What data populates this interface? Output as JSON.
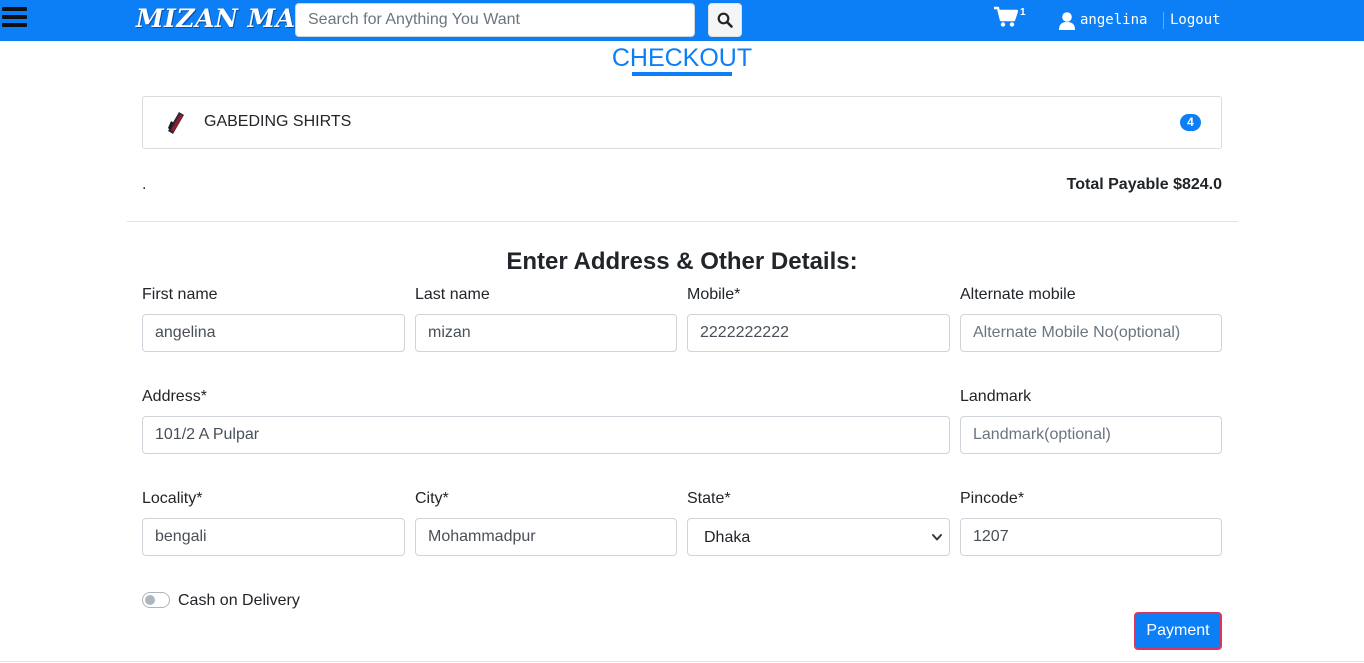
{
  "nav": {
    "brand": "MIZAN MART",
    "search_placeholder": "Search for Anything You Want",
    "cart_count": "1",
    "username": "angelina",
    "logout_label": "Logout"
  },
  "checkout": {
    "title": "CHECKOUT",
    "item": {
      "name": "GABEDING SHIRTS",
      "qty": "4"
    },
    "dot": ".",
    "total_label": "Total Payable $824.0"
  },
  "form": {
    "title": "Enter Address & Other Details:",
    "first_name": {
      "label": "First name",
      "value": "angelina"
    },
    "last_name": {
      "label": "Last name",
      "value": "mizan"
    },
    "mobile": {
      "label": "Mobile*",
      "value": "2222222222"
    },
    "alt_mobile": {
      "label": "Alternate mobile",
      "value": "",
      "placeholder": "Alternate Mobile No(optional)"
    },
    "address": {
      "label": "Address*",
      "value": "101/2 A Pulpar"
    },
    "landmark": {
      "label": "Landmark",
      "value": "",
      "placeholder": "Landmark(optional)"
    },
    "locality": {
      "label": "Locality*",
      "value": "bengali"
    },
    "city": {
      "label": "City*",
      "value": "Mohammadpur"
    },
    "state": {
      "label": "State*",
      "value": "Dhaka"
    },
    "pincode": {
      "label": "Pincode*",
      "value": "1207"
    },
    "cod_label": "Cash on Delivery",
    "payment_button": "Payment"
  },
  "colors": {
    "primary": "#0d7ff6",
    "button_border": "#d9385a"
  },
  "icons": [
    "menu-icon",
    "search-icon",
    "cart-icon",
    "user-icon",
    "shirt-thumbnail",
    "chevron-down-icon"
  ]
}
